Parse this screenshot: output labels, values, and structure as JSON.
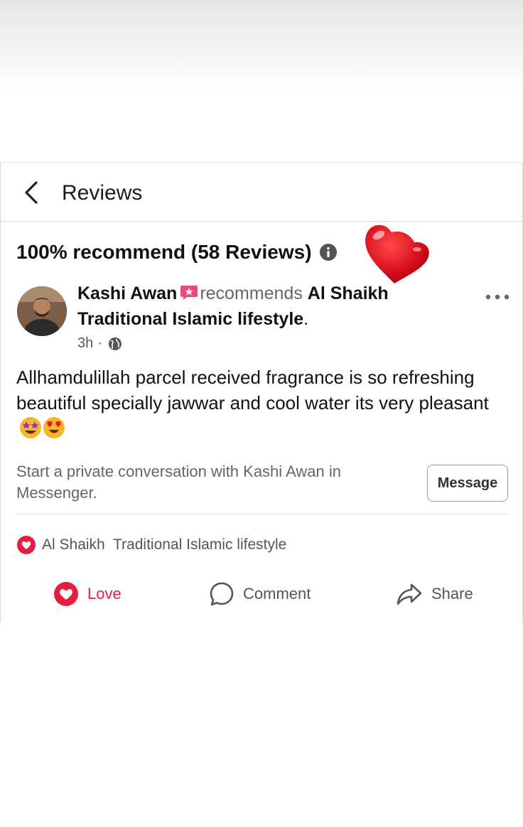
{
  "header": {
    "title": "Reviews"
  },
  "summary": {
    "text": "100% recommend (58 Reviews)"
  },
  "post": {
    "author": "Kashi Awan",
    "recommends": "recommends",
    "page_name": "Al Shaikh Traditional Islamic lifestyle",
    "page_suffix": ".",
    "time": "3h",
    "separator": "·",
    "body": "Allhamdulillah parcel received fragrance is so refreshing beautiful specially jawwar and cool water its very pleasant"
  },
  "private": {
    "text": "Start a private conversation with Kashi Awan in Messenger.",
    "button_label": "Message"
  },
  "reactions": {
    "text": "Al Shaikh  Traditional Islamic lifestyle"
  },
  "actions": {
    "love": "Love",
    "comment": "Comment",
    "share": "Share"
  },
  "colors": {
    "love": "#e41e3f",
    "secondary_text": "#666666"
  },
  "icons": [
    "back-icon",
    "info-icon",
    "heart-sticker-icon",
    "badge-icon",
    "more-icon",
    "globe-icon",
    "star-struck-emoji",
    "heart-eyes-emoji",
    "love-icon",
    "comment-icon",
    "share-icon"
  ]
}
